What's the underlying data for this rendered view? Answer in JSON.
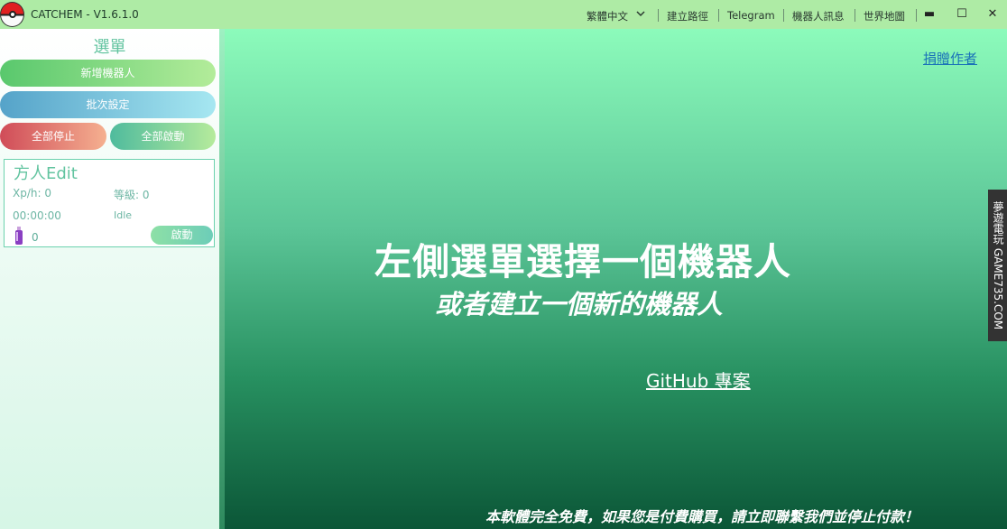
{
  "app": {
    "title": "CATCHEM - V1.6.1.0"
  },
  "topbar": {
    "language": "繁體中文",
    "route": "建立路徑",
    "telegram": "Telegram",
    "bot_info": "機器人訊息",
    "world_map": "世界地圖",
    "minimize": "▬",
    "maximize": "☐",
    "close": "✕"
  },
  "sidebar": {
    "title": "選單",
    "add_bot": "新增機器人",
    "batch_settings": "批次設定",
    "stop_all": "全部停止",
    "start_all": "全部啟動"
  },
  "bot": {
    "name": "方人Edit",
    "xp_label": "Xp/h: 0",
    "level_label": "等級: 0",
    "runtime": "00:00:00",
    "status": "Idle",
    "potion_count": "0",
    "start": "啟動"
  },
  "main": {
    "donate": "捐贈作者",
    "headline": "左側選單選擇一個機器人",
    "subline": "或者建立一個新的機器人",
    "github": "GitHub 專案",
    "footer": "本軟體完全免費，如果您是付費購買，請立即聯繫我們並停止付款！"
  },
  "watermark": "夢遊電玩 GAME735.COM",
  "colors": {
    "titlebar": "#aeeba5",
    "accent": "#63c4a0",
    "main_top": "#8cfbbb",
    "main_bottom": "#0b5637"
  }
}
